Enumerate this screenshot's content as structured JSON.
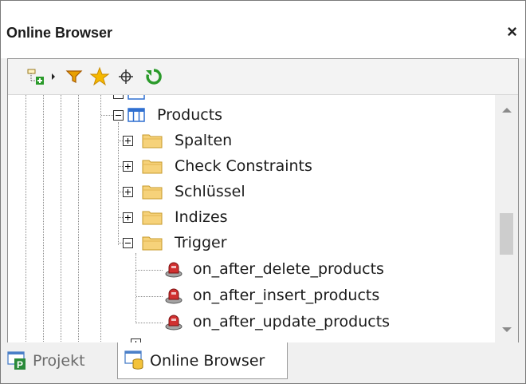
{
  "window": {
    "title": "Online Browser",
    "close_glyph": "×"
  },
  "toolbar": {
    "items": [
      {
        "icon": "add-object-icon"
      },
      {
        "icon": "dropdown-arrow-icon"
      },
      {
        "icon": "filter-icon"
      },
      {
        "icon": "favorites-star-icon"
      },
      {
        "icon": "locate-crosshair-icon"
      },
      {
        "icon": "refresh-icon"
      }
    ]
  },
  "tree": {
    "table": {
      "label": "Products",
      "expanded": true
    },
    "folders": [
      {
        "label": "Spalten",
        "expanded": false
      },
      {
        "label": "Check Constraints",
        "expanded": false
      },
      {
        "label": "Schlüssel",
        "expanded": false
      },
      {
        "label": "Indizes",
        "expanded": false
      },
      {
        "label": "Trigger",
        "expanded": true
      }
    ],
    "triggers": [
      {
        "label": "on_after_delete_products"
      },
      {
        "label": "on_after_insert_products"
      },
      {
        "label": "on_after_update_products"
      }
    ]
  },
  "tabs": [
    {
      "label": "Projekt",
      "active": false,
      "icon": "project-icon"
    },
    {
      "label": "Online Browser",
      "active": true,
      "icon": "online-browser-icon"
    }
  ],
  "colors": {
    "accent_green": "#2a9a2a",
    "folder_yellow": "#f6d27a",
    "table_blue": "#2f6fd0",
    "star_yellow": "#f5b800",
    "filter_orange": "#e8a000",
    "trigger_red": "#d03030"
  }
}
